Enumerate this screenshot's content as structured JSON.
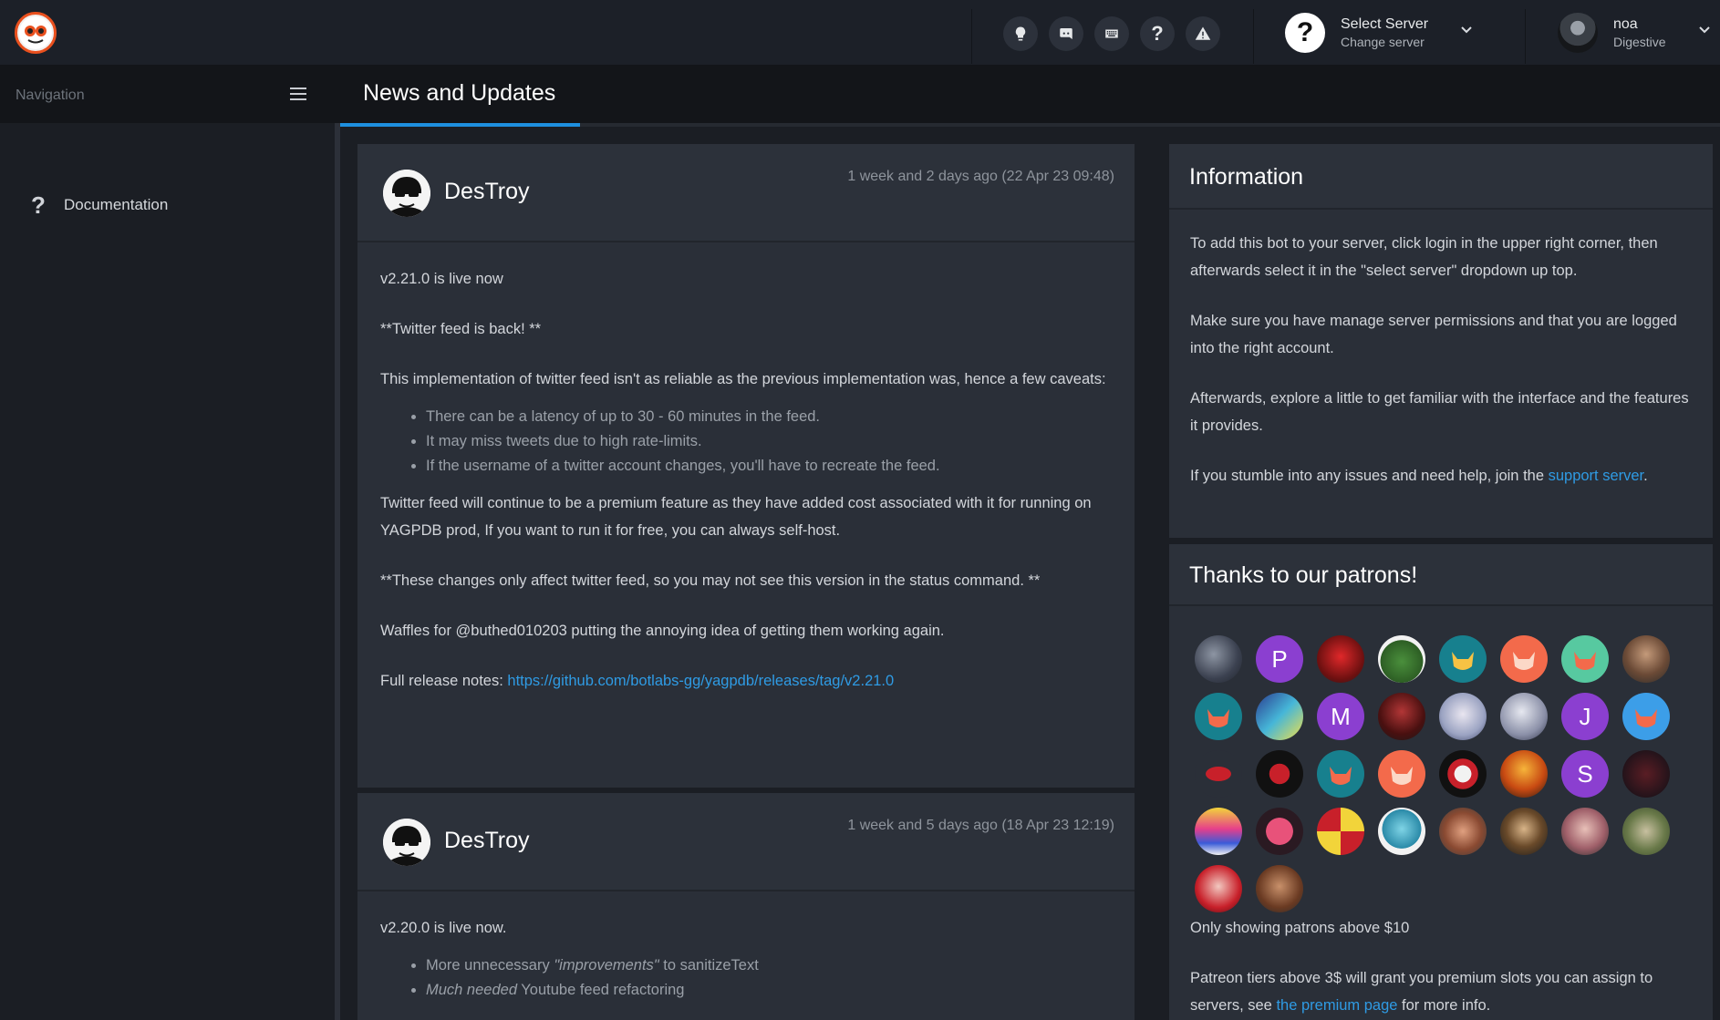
{
  "topbar": {
    "logo_icon": "yagpdb-logo-icon",
    "icons": [
      "lightbulb-icon",
      "discord-icon",
      "keyboard-icon",
      "question-icon",
      "warning-icon"
    ],
    "server": {
      "title": "Select Server",
      "subtitle": "Change server",
      "icon": "question-icon"
    },
    "user": {
      "name": "noa",
      "subtitle": "Digestive"
    }
  },
  "sidebar": {
    "label": "Navigation",
    "items": [
      {
        "label": "Documentation",
        "icon": "question-icon"
      }
    ]
  },
  "page": {
    "title": "News and Updates"
  },
  "news": [
    {
      "author": "DesTroy",
      "timestamp": "1 week and 2 days ago (22 Apr 23 09:48)",
      "p1": "v2.21.0 is live now",
      "p2": "**Twitter feed is back! **",
      "p3": "This implementation of twitter feed isn't as reliable as the previous implementation was, hence a few caveats:",
      "bullets": [
        "There can be a latency of up to 30 - 60 minutes in the feed.",
        "It may miss tweets due to high rate-limits.",
        "If the username of a twitter account changes, you'll have to recreate the feed."
      ],
      "p4": "Twitter feed will continue to be a premium feature as they have added cost associated with it for running on YAGPDB prod, If you want to run it for free, you can always self-host.",
      "p5": "**These changes only affect twitter feed, so you may not see this version in the status command. **",
      "p6": "Waffles for @buthed010203 putting the annoying idea of getting them working again.",
      "p7_prefix": "Full release notes: ",
      "p7_link": "https://github.com/botlabs-gg/yagpdb/releases/tag/v2.21.0"
    },
    {
      "author": "DesTroy",
      "timestamp": "1 week and 5 days ago (18 Apr 23 12:19)",
      "p1": "v2.20.0 is live now.",
      "b1_em": "\"improvements\"",
      "b1_prefix": "More unnecessary ",
      "b1_suffix": " to sanitizeText",
      "b2_em": "Much needed",
      "b2_suffix": " Youtube feed refactoring"
    }
  ],
  "information": {
    "title": "Information",
    "p1": "To add this bot to your server, click login in the upper right corner, then afterwards select it in the \"select server\" dropdown up top.",
    "p2": "Make sure you have manage server permissions and that you are logged into the right account.",
    "p3": "Afterwards, explore a little to get familiar with the interface and the features it provides.",
    "p4_prefix": "If you stumble into any issues and need help, join the ",
    "p4_link": "support server",
    "p4_suffix": "."
  },
  "patrons": {
    "title": "Thanks to our patrons!",
    "letters": {
      "p": "P",
      "m": "M",
      "j": "J",
      "s": "S"
    },
    "colors": {
      "letter_bg": "#8b3fd0",
      "teal": "#17808e",
      "coral": "#f36a4b",
      "mint": "#57c9a0",
      "blue": "#3c9ee8"
    },
    "note": "Only showing patrons above $10",
    "footer_prefix": "Patreon tiers above 3$ will grant you premium slots you can assign to servers, see ",
    "footer_link": "the premium page",
    "footer_suffix": " for more info."
  },
  "colors": {
    "accent": "#1e8fdf",
    "link": "#2f9be4",
    "panel": "#2a2f38",
    "background": "#1b1e24"
  }
}
